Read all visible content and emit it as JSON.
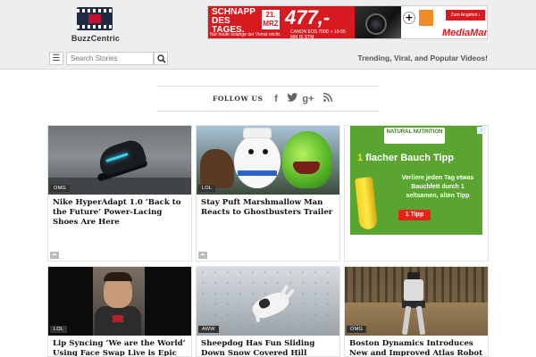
{
  "header": {
    "logo_text": "BuzzCentric",
    "search_placeholder": "Search Stories",
    "tagline": "Trending, Viral, and Popular Videos!"
  },
  "top_ad": {
    "headline": "SCHNAPP DES TAGES.",
    "date_day": "21.",
    "date_month": "MRZ",
    "price": "477,-",
    "fine_print": "Nur heute solange der Vorrat reicht.",
    "product": "CANON EOS 700D + 18-55 MM IS STM",
    "button": "Zum Angebot ›",
    "brand": "MediaMarkt"
  },
  "follow": {
    "label": "FOLLOW US",
    "icons": [
      "facebook-icon",
      "twitter-icon",
      "google-plus-icon",
      "rss-icon"
    ]
  },
  "cards": [
    {
      "tag": "OMG",
      "title": "Nike HyperAdapt 1.0 ‘Back to the Future’ Power-Lacing Shoes Are Here"
    },
    {
      "tag": "LOL",
      "title": "Stay Puft Marshmallow Man Reacts to Ghostbusters Trailer"
    },
    {
      "tag": "LOL",
      "title": "Lip Syncing ‘We are the World’ Using Face Swap Live is Epic"
    },
    {
      "tag": "AWW",
      "title": "Sheepdog Has Fun Sliding Down Snow Covered Hill"
    },
    {
      "tag": "OMG",
      "title": "Boston Dynamics Introduces New and Improved Atlas Robot"
    }
  ],
  "side_ad": {
    "brand": "NATURAL NUTRITION",
    "headline_num": "1",
    "headline": "flacher Bauch Tipp",
    "body": "Verliere jeden Tag etwas Bauchfett durch 1 seltsamen, alten Tipp",
    "button": "1 Tipp"
  },
  "colors": {
    "header_bg": "#eeeeee",
    "ad_red": "#d71920",
    "ad_green": "#5aa431",
    "tag_bg": "#333333"
  }
}
